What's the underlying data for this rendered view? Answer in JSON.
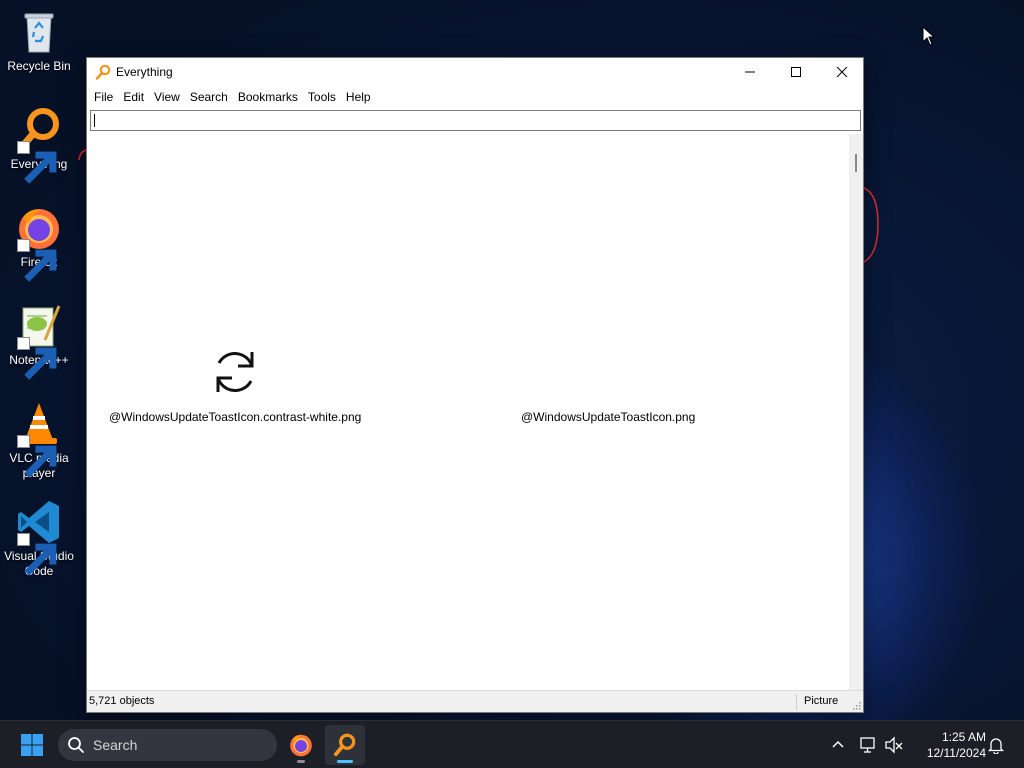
{
  "desktop": {
    "icons": [
      {
        "label": "Recycle Bin",
        "icon": "recycle-bin-icon"
      },
      {
        "label": "Everything",
        "icon": "everything-icon"
      },
      {
        "label": "Firefox",
        "icon": "firefox-icon"
      },
      {
        "label": "Notepad++",
        "icon": "notepad-plus-plus-icon"
      },
      {
        "label": "VLC media player",
        "icon": "vlc-icon"
      },
      {
        "label": "Visual Studio Code",
        "icon": "vscode-icon"
      }
    ]
  },
  "window": {
    "title": "Everything",
    "menu": [
      "File",
      "Edit",
      "View",
      "Search",
      "Bookmarks",
      "Tools",
      "Help"
    ],
    "search": {
      "value": "",
      "placeholder": ""
    },
    "results": [
      {
        "name": "@WindowsUpdateToastIcon.contrast-white.png",
        "icon": "refresh-icon"
      },
      {
        "name": "@WindowsUpdateToastIcon.png",
        "icon": ""
      }
    ],
    "status": {
      "count": "5,721 objects",
      "filter": "Picture"
    }
  },
  "taskbar": {
    "search_label": "Search",
    "apps": [
      {
        "name": "Firefox",
        "icon": "firefox-icon",
        "active": false
      },
      {
        "name": "Everything",
        "icon": "everything-icon",
        "active": true
      }
    ],
    "clock": {
      "time": "1:25 AM",
      "date": "12/11/2024"
    }
  },
  "colors": {
    "accent": "#4cc2ff",
    "everything_orange": "#f7941d",
    "taskbar_bg": "#1c1f26"
  }
}
